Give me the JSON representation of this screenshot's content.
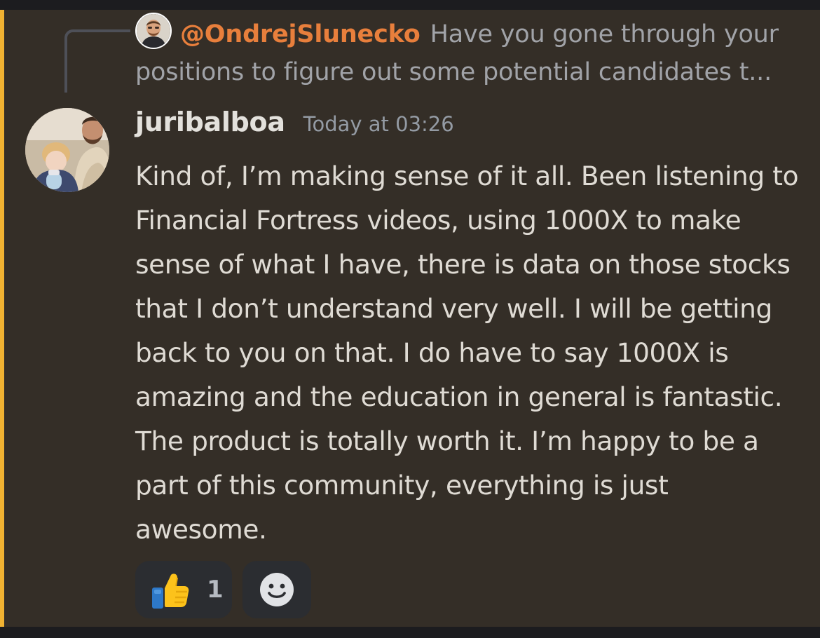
{
  "reply": {
    "author": "@OndrejSlunecko",
    "excerpt": "Have you gone through your positions to figure out some potential candidates t..."
  },
  "message": {
    "username": "juribalboa",
    "timestamp": "Today at 03:26",
    "content": "Kind of, I’m making sense of it all. Been listening to Financial Fortress videos, using 1000X to make sense of what I have, there is data on those stocks that I don’t understand very well. I will be getting back to you on that. I do have to say 1000X is amazing and the education in general is fantastic. The product is totally worth it. I’m happy to be a part of this community, everything is just awesome."
  },
  "reactions": [
    {
      "emoji": "thumbs-up-icon",
      "count": "1"
    }
  ],
  "add_reaction": {
    "icon": "smiley-face-icon"
  },
  "colors": {
    "mention_highlight": "#f0b232",
    "reply_author": "#e87f3c",
    "message_background": "#342e27"
  }
}
